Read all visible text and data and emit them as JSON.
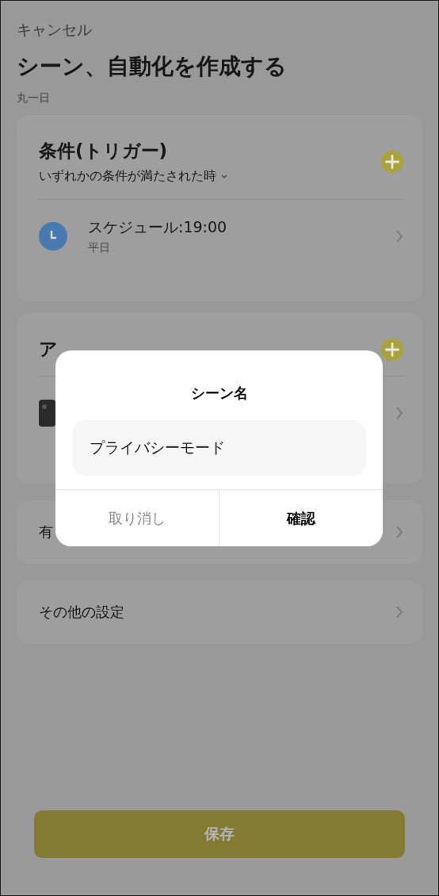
{
  "header": {
    "cancel": "キャンセル",
    "title": "シーン、自動化を作成する",
    "subtitle": "丸一日"
  },
  "conditions": {
    "title": "条件(トリガー)",
    "mode": "いずれかの条件が満たされた時",
    "items": [
      {
        "title": "スケジュール:19:00",
        "subtitle": "平日"
      }
    ]
  },
  "actions": {
    "title": "ア"
  },
  "rows": [
    {
      "label": "有"
    },
    {
      "label": "その他の設定"
    }
  ],
  "save_button": {
    "label": "保存"
  },
  "dialog": {
    "title": "シーン名",
    "value": "プライバシーモード",
    "buttons": [
      {
        "label": "取り消し",
        "kind": "cancel"
      },
      {
        "label": "確認",
        "kind": "confirm"
      }
    ]
  }
}
